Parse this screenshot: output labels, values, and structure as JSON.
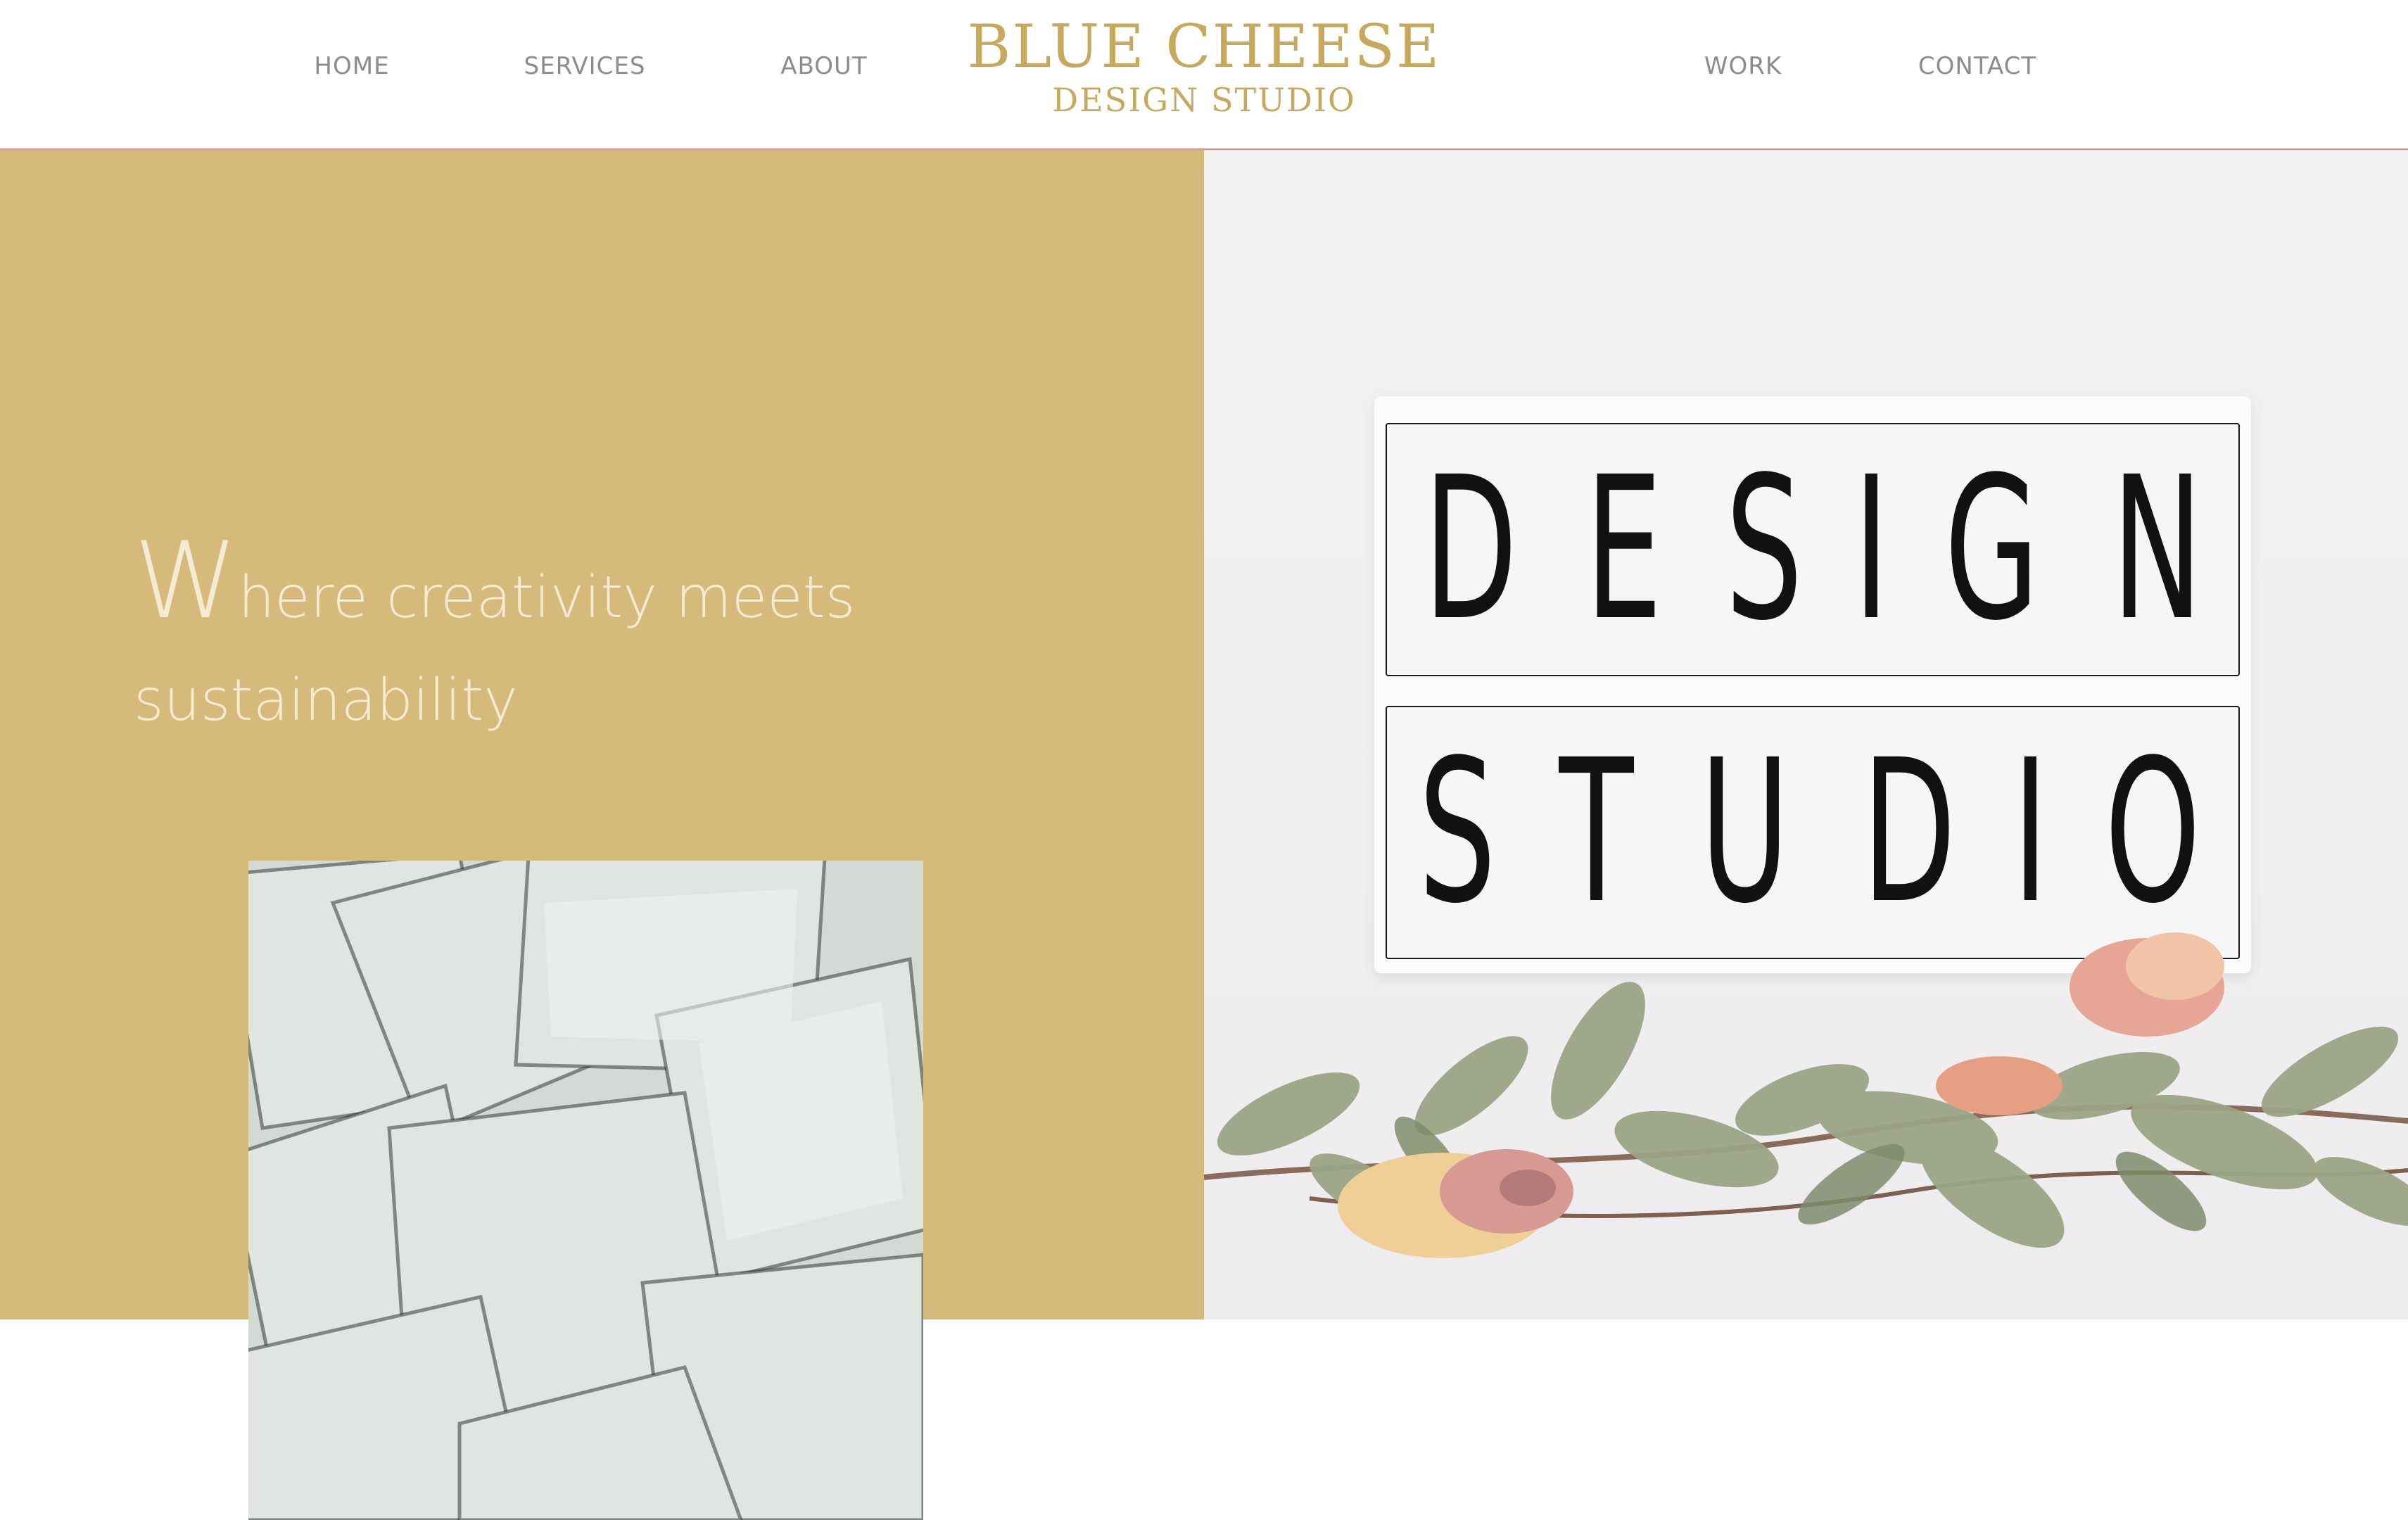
{
  "brand": {
    "name": "BLUE CHEESE",
    "subtitle": "DESIGN STUDIO",
    "color": "#c8a95c"
  },
  "nav": {
    "left": [
      {
        "label": "HOME"
      },
      {
        "label": "SERVICES"
      },
      {
        "label": "ABOUT"
      }
    ],
    "right": [
      {
        "label": "WORK"
      },
      {
        "label": "CONTACT"
      }
    ]
  },
  "hero": {
    "tagline_initial": "W",
    "tagline_rest": "here creativity meets",
    "tagline_line2": "sustainability",
    "panel_color": "#d5ba7c",
    "text_color": "#f4ebd2"
  },
  "lightbox": {
    "line1": [
      "D",
      "E",
      "S",
      "I",
      "G",
      "N"
    ],
    "line2": [
      "S",
      "T",
      "U",
      "D",
      "I",
      "O"
    ]
  }
}
